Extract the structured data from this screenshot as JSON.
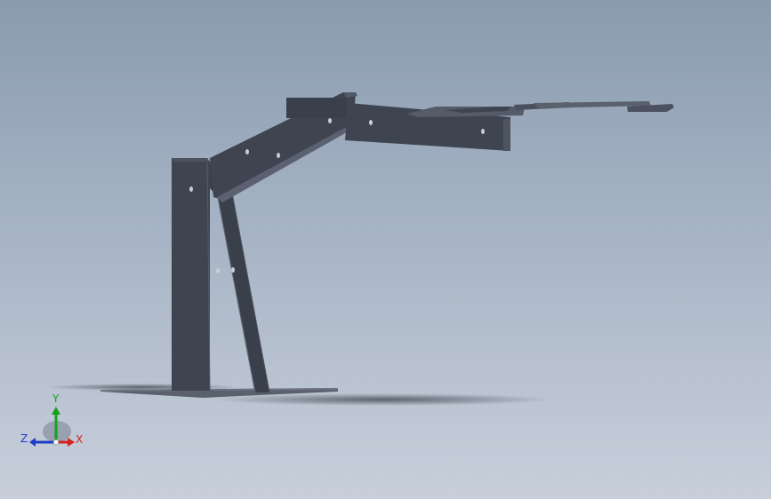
{
  "triad": {
    "x_label": "X",
    "y_label": "Y",
    "z_label": "Z"
  },
  "colors": {
    "background_top": "#8a9bb0",
    "background_bottom": "#c8cfdb",
    "part_fill": "#3e4450",
    "axis_x": "#d32020",
    "axis_y": "#16a020",
    "axis_z": "#1e3cc8"
  },
  "icons": {
    "triad": "xyz-axis-triad-icon"
  }
}
